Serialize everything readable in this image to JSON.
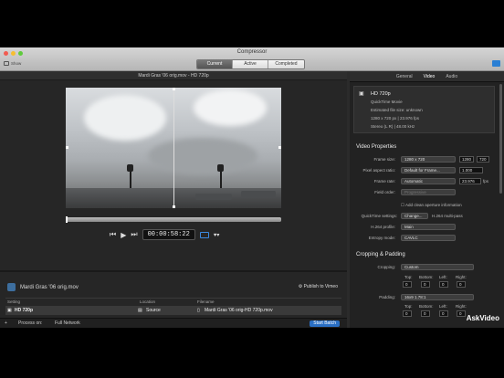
{
  "window": {
    "title": "Compressor",
    "show_label": "Show"
  },
  "tabs": [
    "Current",
    "Active",
    "Completed"
  ],
  "viewer": {
    "title": "Mardi Gras '06 orig.mov - HD 720p",
    "timecode": "00:00:58:22"
  },
  "job": {
    "name": "Mardi Gras '06 orig.mov",
    "publish": "Publish to Vimeo",
    "columns": {
      "setting": "Setting",
      "location": "Location",
      "filename": "Filename"
    },
    "row": {
      "setting": "HD 720p",
      "location": "Source",
      "filename": "Mardi Gras '06 orig-HD 720p.mov"
    }
  },
  "bottom_bar": {
    "add": "+",
    "process_label": "Process on:",
    "process_value": "Full Network",
    "start": "Start Batch"
  },
  "inspector": {
    "tabs": [
      "General",
      "Video",
      "Audio"
    ],
    "summary": {
      "name": "HD 720p",
      "format": "QuickTime Movie",
      "filesize": "Estimated file size: unknown",
      "video": "1280 x 720 px | 23.976 fps",
      "audio": "Stereo (L R) | 48.00 kHz"
    },
    "video_props": {
      "heading": "Video Properties",
      "frame_size_label": "Frame size:",
      "frame_size": "1280 x 720",
      "w": "1280",
      "h": "720",
      "par_label": "Pixel aspect ratio:",
      "par": "Default for Frame...",
      "par_val": "1.000",
      "rate_label": "Frame rate:",
      "rate": "Automatic",
      "rate_val": "23.976",
      "fps": "fps",
      "order_label": "Field order:",
      "order": "Progressive",
      "clean": "Add clean aperture information",
      "qt_label": "QuickTime settings:",
      "qt_button": "Change...",
      "qt_value": "H.264 multi-pass",
      "profile_label": "H.264 profile:",
      "profile": "Main",
      "entropy_label": "Entropy mode:",
      "entropy": "CAVLC"
    },
    "crop": {
      "heading": "Cropping & Padding",
      "cropping_label": "Cropping:",
      "cropping": "Custom",
      "padding_label": "Padding:",
      "padding": "16x9 1.78:1",
      "sides": [
        "Top:",
        "Bottom:",
        "Left:",
        "Right:"
      ],
      "values": [
        "0",
        "0",
        "0",
        "0"
      ]
    }
  },
  "watermark": "AskVideo"
}
